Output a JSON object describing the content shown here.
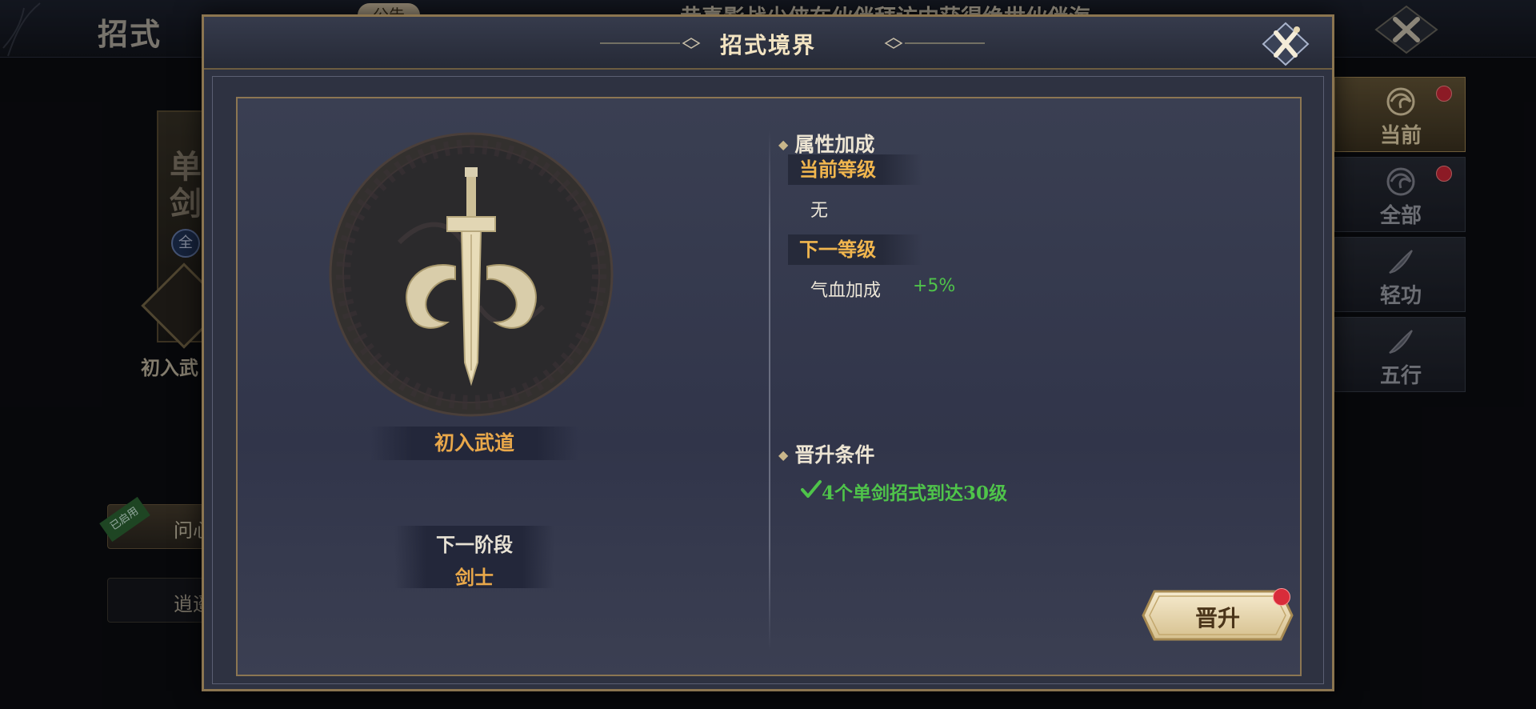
{
  "background": {
    "page_title": "招式",
    "left_panel": {
      "vertical_chars": [
        "单",
        "剑"
      ],
      "badge": "全",
      "label": "初入武",
      "button_1": "问心",
      "button_1_ribbon": "已启用",
      "button_2": "逍遥"
    },
    "notice_label": "公告",
    "marquee_text": "恭喜影战少侠在伙伴拜访中获得绝世伙伴海",
    "side_tabs": [
      {
        "label": "当前",
        "icon": "swirl-icon",
        "active": true,
        "red_dot": true
      },
      {
        "label": "全部",
        "icon": "swirl-icon",
        "active": false,
        "red_dot": true
      },
      {
        "label": "轻功",
        "icon": "feather-icon",
        "active": false,
        "red_dot": false
      },
      {
        "label": "五行",
        "icon": "feather-icon",
        "active": false,
        "red_dot": false
      }
    ]
  },
  "modal": {
    "title": "招式境界",
    "current_realm": "初入武道",
    "next_stage_label": "下一阶段",
    "next_stage_value": "剑士",
    "attributes": {
      "section_title": "属性加成",
      "current_level_label": "当前等级",
      "current_level_value": "无",
      "next_level_label": "下一等级",
      "next_level_stat": "气血加成",
      "next_level_bonus": "+5%"
    },
    "requirements": {
      "section_title": "晋升条件",
      "condition_1": "4个单剑招式到达30级",
      "condition_1_met": true
    },
    "promote_button": "晋升"
  },
  "colors": {
    "accent_gold": "#e9a84a",
    "success_green": "#4fc44a",
    "notification_red": "#d82c3a",
    "frame_gold": "#8c7652"
  }
}
